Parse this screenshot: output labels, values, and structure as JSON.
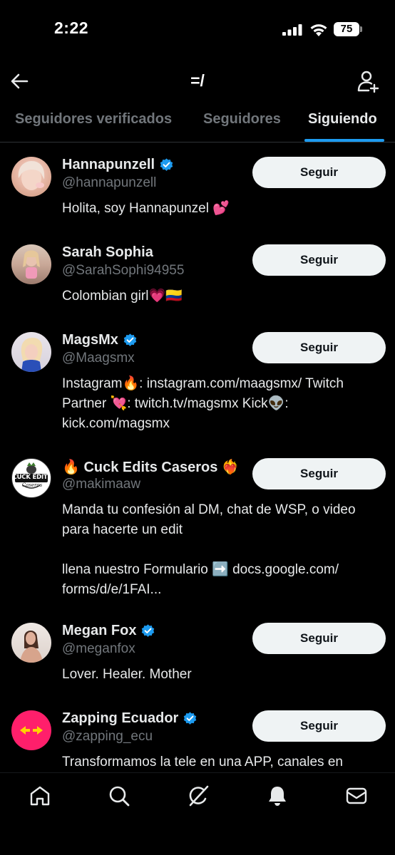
{
  "status_bar": {
    "time": "2:22",
    "battery": "75"
  },
  "header": {
    "back_icon": "arrow-left-icon",
    "title": "=/",
    "add_user_icon": "person-plus-icon"
  },
  "tabs": [
    {
      "label": "Seguidores verificados",
      "active": false
    },
    {
      "label": "Seguidores",
      "active": false
    },
    {
      "label": "Siguiendo",
      "active": true
    }
  ],
  "users": [
    {
      "name": "Hannapunzell",
      "verified": true,
      "handle": "@hannapunzell",
      "bio_lines": [
        "Holita, soy Hannapunzel 💕"
      ],
      "button": "Seguir"
    },
    {
      "name": "Sarah Sophia",
      "verified": false,
      "handle": "@SarahSophi94955",
      "bio_lines": [
        "Colombian girl💗🇨🇴"
      ],
      "button": "Seguir"
    },
    {
      "name": "MagsMx",
      "verified": true,
      "handle": "@Maagsmx",
      "bio_lines": [
        "Instagram🔥: instagram.com/maagsmx/ Twitch",
        "Partner 💘: twitch.tv/magsmx Kick👽:",
        "kick.com/magsmx"
      ],
      "button": "Seguir"
    },
    {
      "name": "🔥 Cuck Edits Caseros ❤️‍🔥",
      "verified": false,
      "handle": "@makimaaw",
      "avatar_text": "CUCK EDITS",
      "avatar_subtext": "Caseros",
      "bio_lines": [
        "Manda tu confesión al DM, chat de WSP, o video",
        "para hacerte un edit",
        "",
        "llena nuestro Formulario ➡️ docs.google.com/",
        "forms/d/e/1FAI..."
      ],
      "button": "Seguir"
    },
    {
      "name": "Megan Fox",
      "verified": true,
      "handle": "@meganfox",
      "bio_lines": [
        "Lover. Healer. Mother"
      ],
      "button": "Seguir"
    },
    {
      "name": "Zapping Ecuador",
      "verified": true,
      "handle": "@zapping_ecu",
      "bio_lines": [
        "Transformamos la tele en una APP, canales en"
      ],
      "button": "Seguir"
    }
  ],
  "bottom_nav": [
    "home-icon",
    "search-icon",
    "grok-icon",
    "bell-icon",
    "mail-icon"
  ],
  "colors": {
    "background": "#000000",
    "accent": "#1d9bf0",
    "secondary_text": "#71767b",
    "button_bg": "#eff3f4",
    "zapping_pink": "#ff1f6b"
  }
}
